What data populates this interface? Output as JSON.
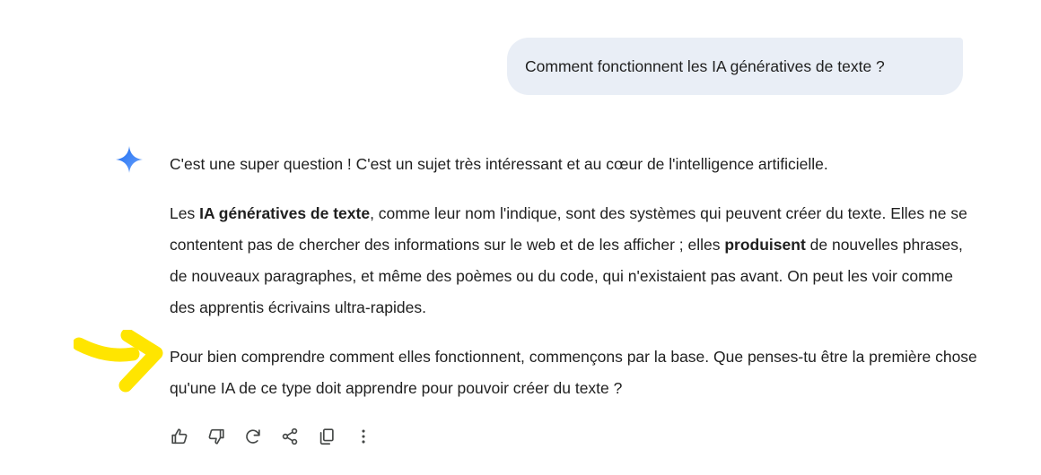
{
  "user_message": "Comment fonctionnent les IA génératives de texte ?",
  "response": {
    "p1": "C'est une super question ! C'est un sujet très intéressant et au cœur de l'intelligence artificielle.",
    "p2": {
      "pre": "Les ",
      "bold1": "IA génératives de texte",
      "mid1": ", comme leur nom l'indique, sont des systèmes qui peuvent créer du texte. Elles ne se contentent pas de chercher des informations sur le web et de les afficher ; elles ",
      "bold2": "produisent",
      "post": " de nouvelles phrases, de nouveaux paragraphes, et même des poèmes ou du code, qui n'existaient pas avant. On peut les voir comme des apprentis écrivains ultra-rapides."
    },
    "p3": "Pour bien comprendre comment elles fonctionnent, commençons par la base. Que penses-tu être la première chose qu'une IA de ce type doit apprendre pour pouvoir créer du texte ?"
  },
  "actions": [
    {
      "icon": "thumb-up-icon"
    },
    {
      "icon": "thumb-down-icon"
    },
    {
      "icon": "regenerate-icon"
    },
    {
      "icon": "share-icon"
    },
    {
      "icon": "copy-icon"
    },
    {
      "icon": "more-vert-icon"
    }
  ],
  "colors": {
    "user_bubble": "#e9eef6",
    "text": "#1f1f1f",
    "icon": "#444746",
    "spark_start": "#4285f4",
    "spark_end": "#9b72cb",
    "annotation_arrow": "#ffe500"
  }
}
